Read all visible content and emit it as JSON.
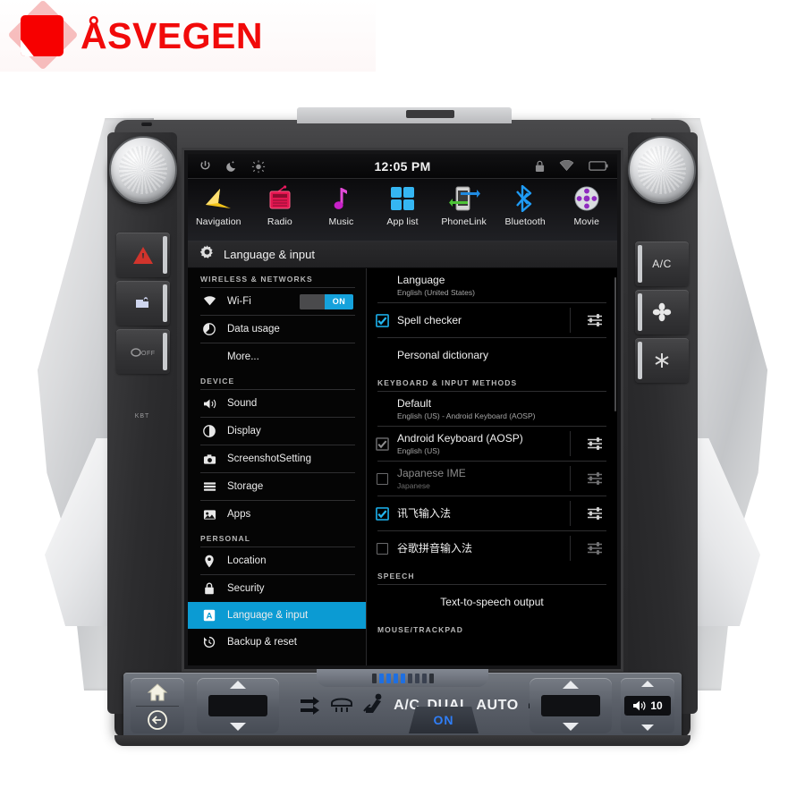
{
  "brand": {
    "name": "ÅSVEGEN"
  },
  "head_unit": {
    "status_bar": {
      "time": "12:05 PM",
      "left_icons": [
        "power-icon",
        "night-mode-icon",
        "brightness-icon"
      ],
      "right_icons": [
        "lock-icon",
        "wifi-icon",
        "battery-icon"
      ]
    },
    "app_dock": [
      {
        "label": "Navigation",
        "icon": "navigation-arrow-icon"
      },
      {
        "label": "Radio",
        "icon": "radio-icon"
      },
      {
        "label": "Music",
        "icon": "music-note-icon"
      },
      {
        "label": "App list",
        "icon": "app-grid-icon"
      },
      {
        "label": "PhoneLink",
        "icon": "phonelink-icon"
      },
      {
        "label": "Bluetooth",
        "icon": "bluetooth-icon"
      },
      {
        "label": "Movie",
        "icon": "movie-reel-icon"
      }
    ],
    "settings": {
      "title": "Language & input",
      "title_icon": "gear-icon",
      "sidebar": [
        {
          "type": "header",
          "label": "WIRELESS & NETWORKS"
        },
        {
          "type": "item",
          "label": "Wi-Fi",
          "icon": "wifi-icon",
          "toggle": "ON",
          "selected": false
        },
        {
          "type": "item",
          "label": "Data usage",
          "icon": "data-usage-icon",
          "selected": false
        },
        {
          "type": "item",
          "label": "More...",
          "icon": null,
          "selected": false
        },
        {
          "type": "header",
          "label": "DEVICE"
        },
        {
          "type": "item",
          "label": "Sound",
          "icon": "sound-icon",
          "selected": false
        },
        {
          "type": "item",
          "label": "Display",
          "icon": "display-icon",
          "selected": false
        },
        {
          "type": "item",
          "label": "ScreenshotSetting",
          "icon": "camera-icon",
          "selected": false
        },
        {
          "type": "item",
          "label": "Storage",
          "icon": "storage-icon",
          "selected": false
        },
        {
          "type": "item",
          "label": "Apps",
          "icon": "apps-icon",
          "selected": false
        },
        {
          "type": "header",
          "label": "PERSONAL"
        },
        {
          "type": "item",
          "label": "Location",
          "icon": "location-pin-icon",
          "selected": false
        },
        {
          "type": "item",
          "label": "Security",
          "icon": "lock-icon",
          "selected": false
        },
        {
          "type": "item",
          "label": "Language & input",
          "icon": "language-icon",
          "selected": true
        },
        {
          "type": "item",
          "label": "Backup & reset",
          "icon": "backup-reset-icon",
          "selected": false
        }
      ],
      "detail": [
        {
          "type": "row",
          "title": "Language",
          "subtitle": "English (United States)",
          "checkbox": null,
          "gear": false
        },
        {
          "type": "row",
          "title": "Spell checker",
          "subtitle": null,
          "checkbox": "checked",
          "gear": true
        },
        {
          "type": "row",
          "title": "Personal dictionary",
          "subtitle": null,
          "checkbox": null,
          "gear": false
        },
        {
          "type": "header",
          "label": "KEYBOARD & INPUT METHODS"
        },
        {
          "type": "row",
          "title": "Default",
          "subtitle": "English (US) - Android Keyboard (AOSP)",
          "checkbox": null,
          "gear": false
        },
        {
          "type": "row",
          "title": "Android Keyboard (AOSP)",
          "subtitle": "English (US)",
          "checkbox": "checked-dim",
          "gear": true
        },
        {
          "type": "row",
          "title": "Japanese IME",
          "subtitle": "Japanese",
          "checkbox": "unchecked",
          "gear": true,
          "dim": true
        },
        {
          "type": "row",
          "title": "讯飞输入法",
          "subtitle": null,
          "checkbox": "checked",
          "gear": true
        },
        {
          "type": "row",
          "title": "谷歌拼音输入法",
          "subtitle": null,
          "checkbox": "unchecked",
          "gear": true
        },
        {
          "type": "header",
          "label": "SPEECH"
        },
        {
          "type": "row",
          "title": "Text-to-speech output",
          "subtitle": null,
          "checkbox": null,
          "gear": false
        },
        {
          "type": "header",
          "label": "MOUSE/TRACKPAD"
        }
      ]
    }
  },
  "hvac": {
    "nav_buttons": [
      {
        "label": "",
        "icon": "home-icon"
      },
      {
        "label": "",
        "icon": "back-arrow-icon"
      }
    ],
    "left_temp": {
      "up": "▲",
      "down": "▼",
      "display": ""
    },
    "right_temp": {
      "up": "▲",
      "down": "▼",
      "display": ""
    },
    "center_labels": [
      "A/C",
      "DUAL",
      "AUTO"
    ],
    "on_button": "ON",
    "mode_icons": [
      "recirculate-icon",
      "front-defrost-icon",
      "seat-airflow-icon",
      "rear-defrost-icon",
      "windshield-icon"
    ],
    "volume": {
      "value": "10",
      "icon": "speaker-icon",
      "up": "▲",
      "down": "▼"
    }
  },
  "side_panels": {
    "left_buttons": [
      {
        "icon": "hazard-triangle-icon",
        "label": ""
      },
      {
        "icon": "door-lock-icon",
        "label": ""
      },
      {
        "icon": "vsc-off-icon",
        "label": ""
      }
    ],
    "left_label": "KBT",
    "right_buttons": [
      {
        "icon": "ac-text-icon",
        "label": "A/C"
      },
      {
        "icon": "fan-icon",
        "label": ""
      },
      {
        "icon": "defrost-icon",
        "label": ""
      }
    ],
    "left_knob": "volume-knob",
    "right_knob": "tune-knob"
  },
  "colors": {
    "accent": "#0b9bd3",
    "toggle_on": "#15a2dc",
    "brand_red": "#f10a0a",
    "on_blue": "#2f7ef7"
  }
}
